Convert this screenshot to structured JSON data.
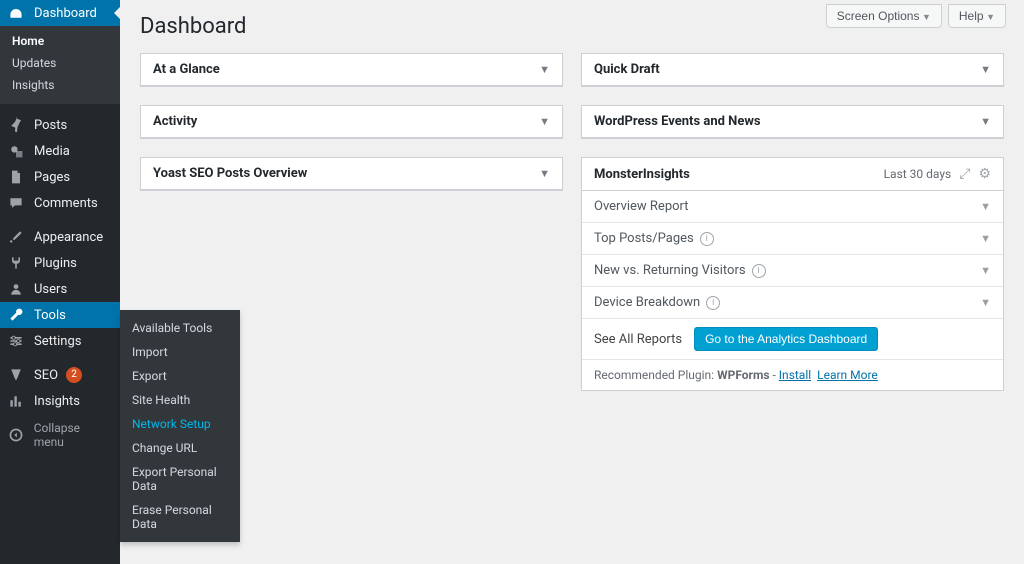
{
  "screenmeta": {
    "screen_options": "Screen Options",
    "help": "Help"
  },
  "page_title": "Dashboard",
  "sidebar": {
    "dashboard": "Dashboard",
    "dashboard_sub": {
      "home": "Home",
      "updates": "Updates",
      "insights": "Insights"
    },
    "posts": "Posts",
    "media": "Media",
    "pages": "Pages",
    "comments": "Comments",
    "appearance": "Appearance",
    "plugins": "Plugins",
    "users": "Users",
    "tools": "Tools",
    "settings": "Settings",
    "seo": "SEO",
    "seo_badge": "2",
    "insights": "Insights",
    "collapse": "Collapse menu"
  },
  "tools_flyout": {
    "available_tools": "Available Tools",
    "import": "Import",
    "export": "Export",
    "site_health": "Site Health",
    "network_setup": "Network Setup",
    "change_url": "Change URL",
    "export_personal": "Export Personal Data",
    "erase_personal": "Erase Personal Data"
  },
  "panels_left": {
    "at_a_glance": "At a Glance",
    "activity": "Activity",
    "yoast": "Yoast SEO Posts Overview"
  },
  "panels_right": {
    "quick_draft": "Quick Draft",
    "events": "WordPress Events and News"
  },
  "mi": {
    "title": "MonsterInsights",
    "range": "Last 30 days",
    "rows": {
      "overview": "Overview Report",
      "top": "Top Posts/Pages",
      "visitors": "New vs. Returning Visitors",
      "device": "Device Breakdown"
    },
    "see_all": "See All Reports",
    "cta": "Go to the Analytics Dashboard",
    "rec_prefix": "Recommended Plugin: ",
    "rec_plugin": "WPForms",
    "rec_sep": " - ",
    "install": "Install",
    "learn": "Learn More"
  }
}
